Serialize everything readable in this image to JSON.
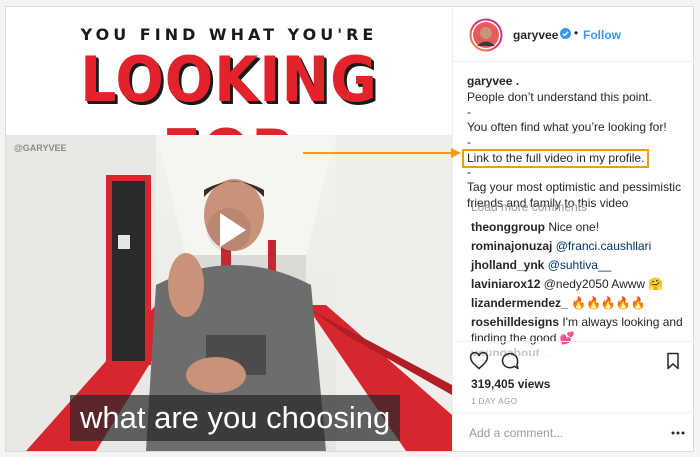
{
  "media": {
    "title_top": "YOU FIND WHAT YOU'RE",
    "title_main": "LOOKING FOR",
    "watermark": "@GARYVEE",
    "subtitle": "what are you choosing"
  },
  "header": {
    "username": "garyvee",
    "dot": "•",
    "follow_label": "Follow"
  },
  "caption": {
    "username": "garyvee .",
    "line1": "People don’t understand this point.",
    "dash1": "-",
    "line2": "You often find what you’re looking for!",
    "dash2": "-",
    "line3": "Link to the full video in my profile.",
    "dash3": "-",
    "line4": "Tag your most optimistic and pessimistic",
    "line5": "friends and family to this video"
  },
  "load_more": "Load more comments",
  "comments": [
    {
      "user": "theonggroup",
      "text": "Nice one!"
    },
    {
      "user": "rominajonuzaj",
      "text": "@franci.caushllari"
    },
    {
      "user": "jholland_ynk",
      "text": "@suhtiva__"
    },
    {
      "user": "laviniarox12",
      "text": "@nedy2050 Awww 🤗"
    },
    {
      "user": "lizandermendez_",
      "text": "🔥🔥🔥🔥🔥"
    },
    {
      "user": "rosehilldesigns",
      "text": "I'm always looking and"
    },
    {
      "user": "",
      "text": "finding the good 💕"
    },
    {
      "user": "youngabout",
      "text": "..."
    }
  ],
  "stats": {
    "views": "319,405 views",
    "date": "1 DAY AGO"
  },
  "add_comment": {
    "placeholder": "Add a comment..."
  },
  "colors": {
    "accent": "#3897f0",
    "highlight": "#f39c12",
    "title_red": "#e3232c"
  },
  "icons": [
    "play-icon",
    "verified-badge-icon",
    "heart-icon",
    "comment-icon",
    "bookmark-icon",
    "more-options-icon"
  ]
}
